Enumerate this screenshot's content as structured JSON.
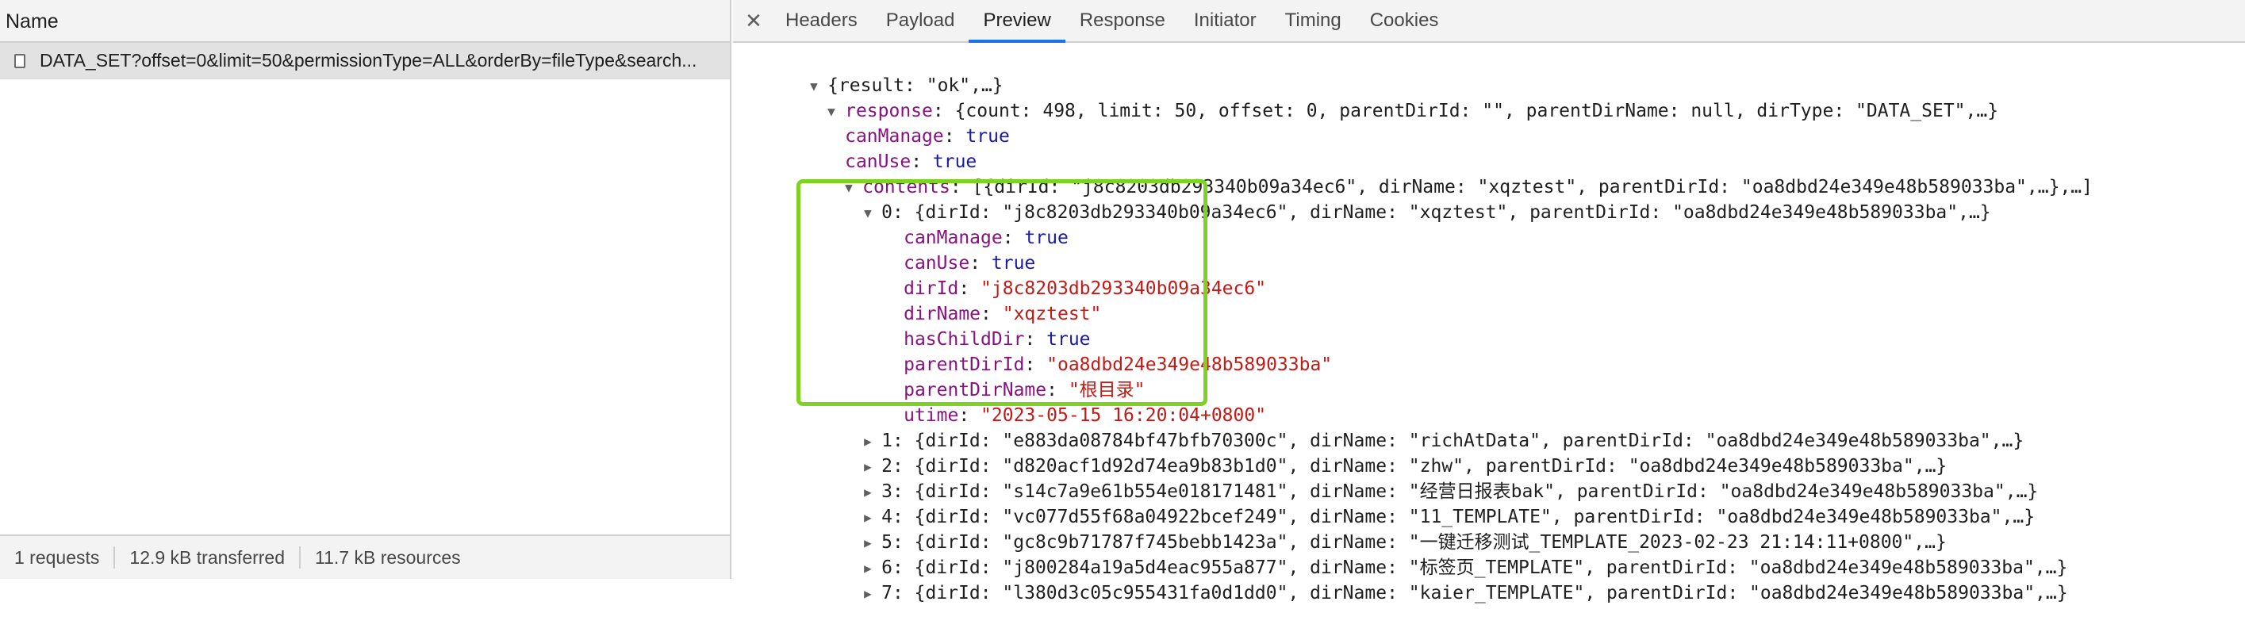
{
  "left": {
    "header": "Name",
    "request": "DATA_SET?offset=0&limit=50&permissionType=ALL&orderBy=fileType&search...",
    "status": [
      "1 requests",
      "12.9 kB transferred",
      "11.7 kB resources"
    ]
  },
  "tabs": [
    "Headers",
    "Payload",
    "Preview",
    "Response",
    "Initiator",
    "Timing",
    "Cookies"
  ],
  "active_tab": "Preview",
  "preview": {
    "root": "{result: \"ok\",…}",
    "response_key": "response",
    "response_summary": "{count: 498, limit: 50, offset: 0, parentDirId: \"\", parentDirName: null, dirType: \"DATA_SET\",…}",
    "can_manage": {
      "key": "canManage",
      "value": "true"
    },
    "can_use": {
      "key": "canUse",
      "value": "true"
    },
    "contents_key": "contents",
    "contents_summary": "[{dirId: \"j8c8203db293340b09a34ec6\", dirName: \"xqztest\", parentDirId: \"oa8dbd24e349e48b589033ba\",…},…]",
    "item0": {
      "summary": "0: {dirId: \"j8c8203db293340b09a34ec6\", dirName: \"xqztest\", parentDirId: \"oa8dbd24e349e48b589033ba\",…}",
      "fields": [
        {
          "key": "canManage",
          "value": "true",
          "kind": "bool"
        },
        {
          "key": "canUse",
          "value": "true",
          "kind": "bool"
        },
        {
          "key": "dirId",
          "value": "\"j8c8203db293340b09a34ec6\"",
          "kind": "str"
        },
        {
          "key": "dirName",
          "value": "\"xqztest\"",
          "kind": "str"
        },
        {
          "key": "hasChildDir",
          "value": "true",
          "kind": "bool"
        },
        {
          "key": "parentDirId",
          "value": "\"oa8dbd24e349e48b589033ba\"",
          "kind": "str"
        },
        {
          "key": "parentDirName",
          "value": "\"根目录\"",
          "kind": "str"
        },
        {
          "key": "utime",
          "value": "\"2023-05-15 16:20:04+0800\"",
          "kind": "str"
        }
      ]
    },
    "collapsed_items": [
      "1: {dirId: \"e883da08784bf47bfb70300c\", dirName: \"richAtData\", parentDirId: \"oa8dbd24e349e48b589033ba\",…}",
      "2: {dirId: \"d820acf1d92d74ea9b83b1d0\", dirName: \"zhw\", parentDirId: \"oa8dbd24e349e48b589033ba\",…}",
      "3: {dirId: \"s14c7a9e61b554e018171481\", dirName: \"经营日报表bak\", parentDirId: \"oa8dbd24e349e48b589033ba\",…}",
      "4: {dirId: \"vc077d55f68a04922bcef249\", dirName: \"11_TEMPLATE\", parentDirId: \"oa8dbd24e349e48b589033ba\",…}",
      "5: {dirId: \"gc8c9b71787f745bebb1423a\", dirName: \"一键迁移测试_TEMPLATE_2023-02-23 21:14:11+0800\",…}",
      "6: {dirId: \"j800284a19a5d4eac955a877\", dirName: \"标签页_TEMPLATE\", parentDirId: \"oa8dbd24e349e48b589033ba\",…}",
      "7: {dirId: \"l380d3c05c955431fa0d1dd0\", dirName: \"kaier_TEMPLATE\", parentDirId: \"oa8dbd24e349e48b589033ba\",…}"
    ]
  },
  "colors": {
    "key": "#881280",
    "string": "#c41a16",
    "boolean": "#1a1aa6",
    "highlight": "#7ed321",
    "active_tab": "#1a73e8"
  }
}
